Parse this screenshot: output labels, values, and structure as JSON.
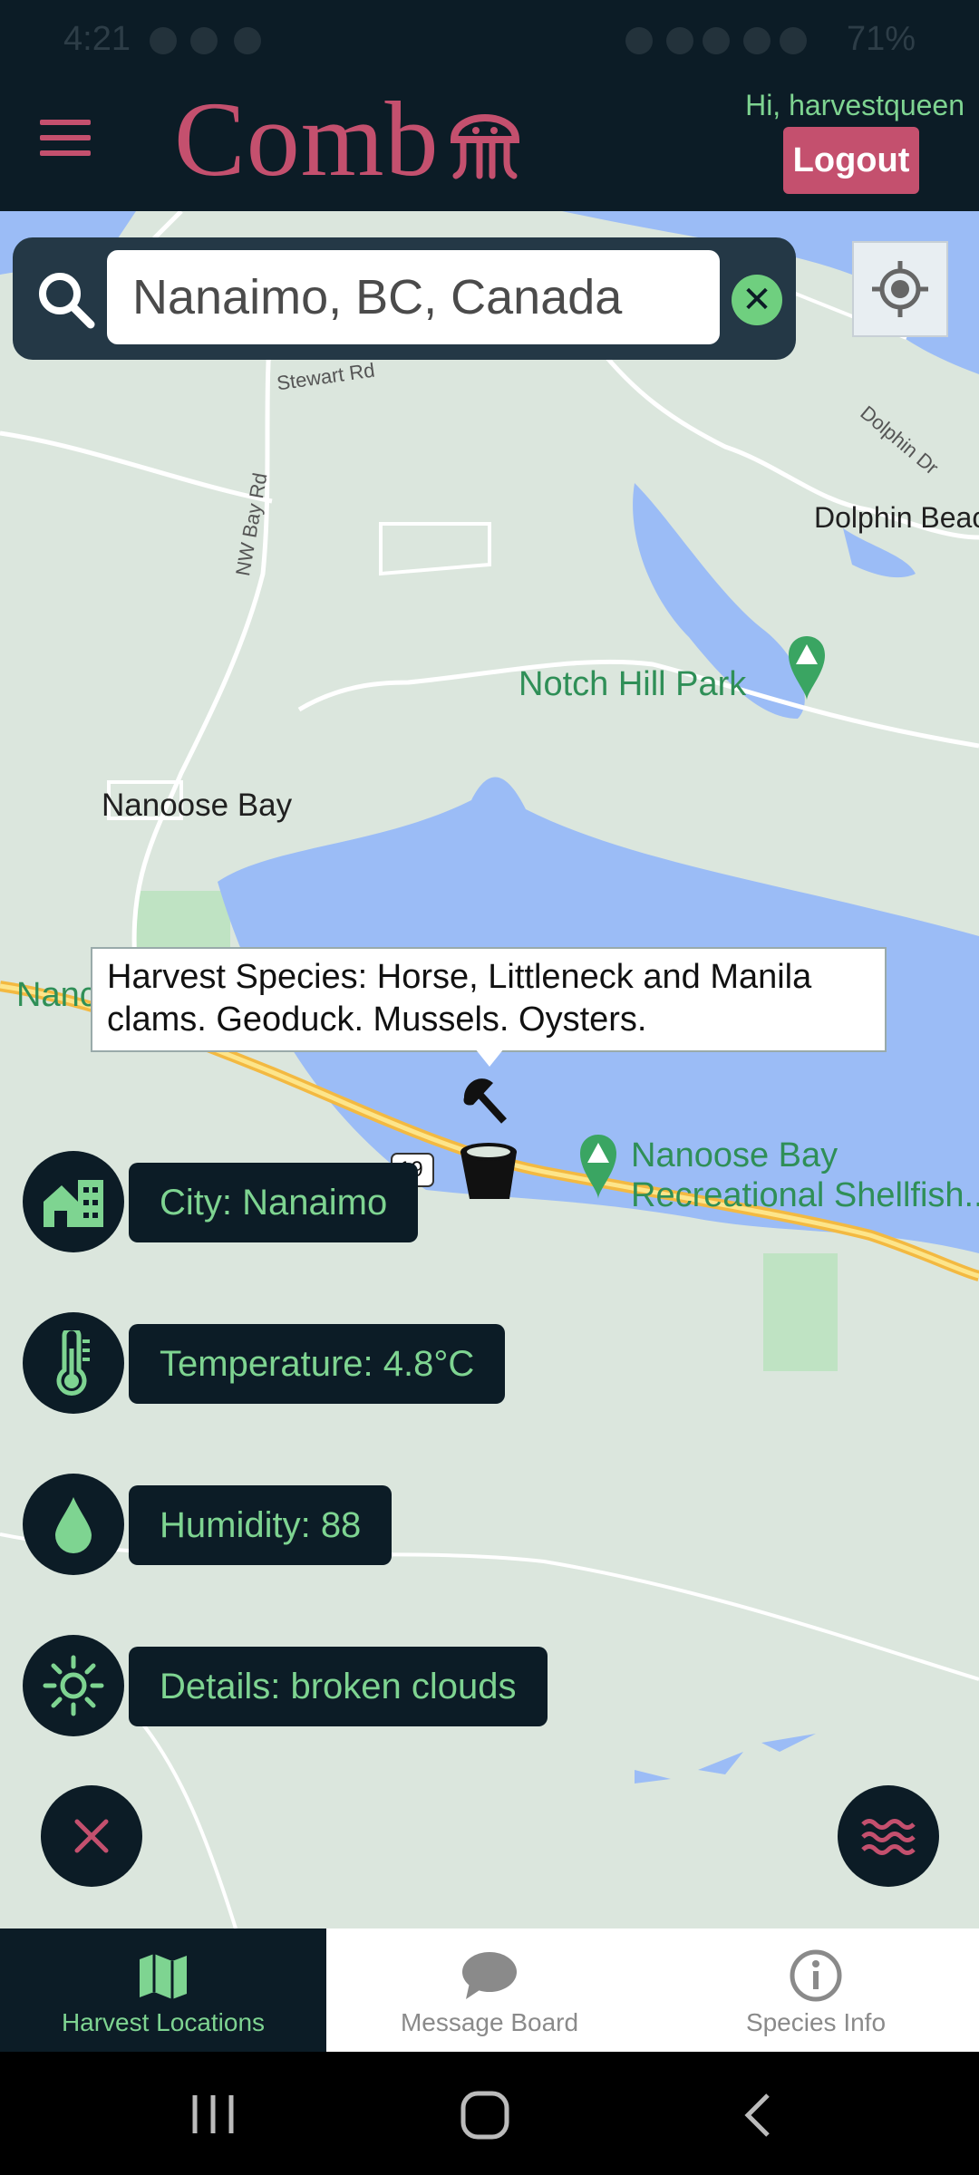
{
  "status_bar": {
    "time": "4:21",
    "battery": "71%"
  },
  "header": {
    "logo_text": "Comb",
    "greeting": "Hi, harvestqueen",
    "logout_label": "Logout"
  },
  "search": {
    "value": "Nanaimo, BC, Canada"
  },
  "map": {
    "labels": {
      "stewart_rd": "Stewart Rd",
      "nw_bay_rd": "NW Bay Rd",
      "dolphin_dr": "Dolphin Dr",
      "dolphin_beach": "Dolphin Beac",
      "notch_hill_park": "Notch Hill Park",
      "nanoose_bay": "Nanoose Bay",
      "nanoose_left": "Nanc",
      "shellfish_line1": "Nanoose Bay",
      "shellfish_line2": "Recreational Shellfish...",
      "highway": "19"
    },
    "tooltip": "Harvest Species: Horse, Littleneck and Manila clams. Geoduck. Mussels. Oysters."
  },
  "info": {
    "city": "City: Nanaimo",
    "temperature": "Temperature: 4.8°C",
    "humidity": "Humidity: 88",
    "details": "Details: broken clouds"
  },
  "bottom_nav": {
    "tabs": [
      {
        "label": "Harvest Locations",
        "active": true
      },
      {
        "label": "Message Board",
        "active": false
      },
      {
        "label": "Species Info",
        "active": false
      }
    ]
  },
  "colors": {
    "brand": "#c4506e",
    "accent_green": "#7ed491",
    "dark": "#0c1c26",
    "water": "#9bbcf6"
  }
}
